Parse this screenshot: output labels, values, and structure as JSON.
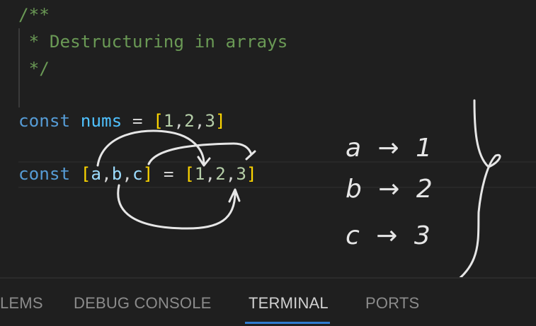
{
  "editor": {
    "lines": {
      "l1": "/**",
      "l2": " * Destructuring in arrays",
      "l3": " */",
      "l5": {
        "kw": "const",
        "name": "nums",
        "eq": " = ",
        "open": "[",
        "v1": "1",
        "c1": ",",
        "v2": "2",
        "c2": ",",
        "v3": "3",
        "close": "]"
      },
      "l7": {
        "kw": "const",
        "open": "[",
        "a": "a",
        "c1": ",",
        "b": "b",
        "c2": ",",
        "c": "c",
        "close": "]",
        "eq": " = ",
        "open2": "[",
        "v1": "1",
        "c3": ",",
        "v2": "2",
        "c4": ",",
        "v3": "3",
        "close2": "]"
      }
    }
  },
  "annotations": {
    "handwritten": [
      "a → 1",
      "b → 2",
      "c → 3"
    ]
  },
  "panel": {
    "tabs": [
      {
        "label": "LEMS"
      },
      {
        "label": "DEBUG CONSOLE"
      },
      {
        "label": "TERMINAL",
        "active": true
      },
      {
        "label": "PORTS"
      }
    ]
  },
  "colors": {
    "comment": "#6a9955",
    "keyword": "#569cd6",
    "bracket": "#ffd700",
    "number": "#b5cea8",
    "accent": "#2f7bd0"
  }
}
